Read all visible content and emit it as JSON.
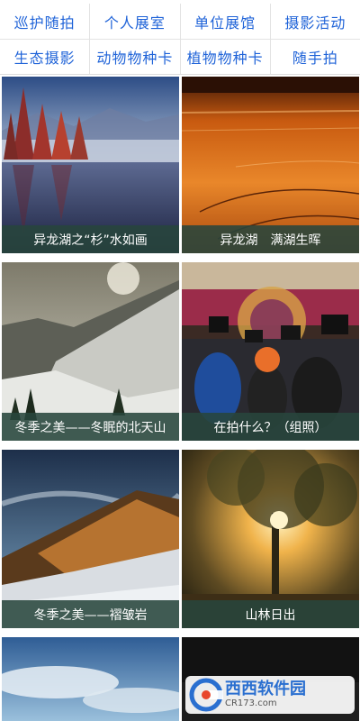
{
  "nav": {
    "row1": [
      "巡护随拍",
      "个人展室",
      "单位展馆",
      "摄影活动"
    ],
    "row2": [
      "生态摄影",
      "动物物种卡",
      "植物物种卡",
      "随手拍"
    ]
  },
  "cards": [
    {
      "caption": "异龙湖之“杉”水如画"
    },
    {
      "caption": "异龙湖　满湖生晖"
    },
    {
      "caption": "冬季之美——冬眠的北天山"
    },
    {
      "caption": "在拍什么？（组照）"
    },
    {
      "caption": "冬季之美——褶皱岩"
    },
    {
      "caption": "山林日出"
    },
    {
      "caption": ""
    },
    {
      "caption": ""
    }
  ],
  "watermark": {
    "title": "西西软件园",
    "site": "CR173.com"
  },
  "colors": {
    "nav_text": "#1f63d8",
    "caption_bg": "#28463c"
  }
}
